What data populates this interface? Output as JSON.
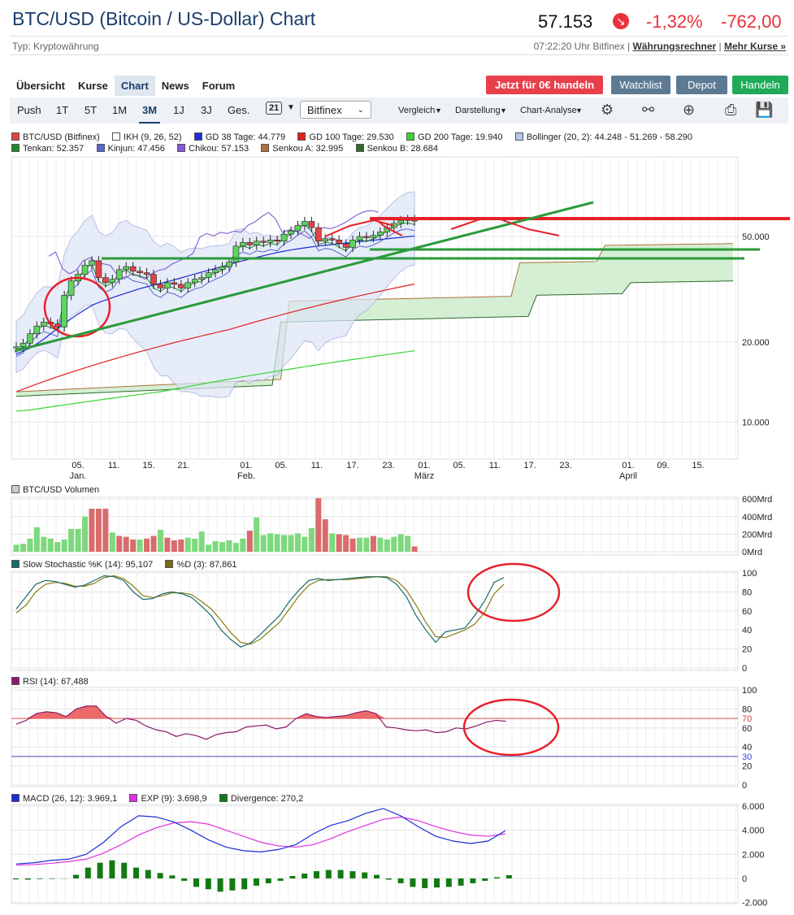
{
  "header": {
    "title": "BTC/USD (Bitcoin / US-Dollar) Chart",
    "price": "57.153",
    "change_pct": "-1,32%",
    "change_abs": "-762,00",
    "type_label": "Typ: Kryptowährung",
    "update_text": "07:22:20 Uhr Bitfinex |",
    "link_rechner": "Währungsrechner",
    "link_kurse": "Mehr Kurse »"
  },
  "nav": {
    "tabs": [
      "Übersicht",
      "Kurse",
      "Chart",
      "News",
      "Forum"
    ],
    "active_tab": "Chart",
    "trade_button": "Jetzt für 0€ handeln",
    "watchlist_button": "Watchlist",
    "depot_button": "Depot",
    "handeln_button": "Handeln"
  },
  "toolbar": {
    "ranges": [
      "Push",
      "1T",
      "5T",
      "1M",
      "3M",
      "1J",
      "3J",
      "Ges."
    ],
    "active_range": "3M",
    "calendar_day": "21",
    "exchange": "Bitfinex",
    "vergleich": "Vergleich",
    "darstellung": "Darstellung",
    "analyse": "Chart-Analyse"
  },
  "colors": {
    "up": "#5fd35f",
    "down": "#e04545",
    "gd38": "#1b2dd6",
    "gd100": "#e02020",
    "gd200": "#34d534",
    "boll": "#9aa8dd",
    "tenkan": "#1f8a2a",
    "kinjun": "#5566cc",
    "chikou": "#7a4dcc",
    "annotation": "#e8202a",
    "trend": "#2a9a3a"
  },
  "legend_main": [
    {
      "text": "BTC/USD (Bitfinex)",
      "color": "#e04545"
    },
    {
      "text": "IKH (9, 26, 52)",
      "color": "#ffffff"
    },
    {
      "text": "GD 38 Tage: 44.779",
      "color": "#1b2dd6"
    },
    {
      "text": "GD 100 Tage: 29.530",
      "color": "#e02020"
    },
    {
      "text": "GD 200 Tage: 19.940",
      "color": "#34d534"
    },
    {
      "text": "Bollinger (20, 2): 44.248 - 51.269 - 58.290",
      "color": "#b8c4e8"
    },
    {
      "text": "Tenkan: 52.357",
      "color": "#1f8a2a"
    },
    {
      "text": "Kinjun: 47.456",
      "color": "#5566cc"
    },
    {
      "text": "Chikou: 57.153",
      "color": "#8855dd"
    },
    {
      "text": "Senkou A: 32.995",
      "color": "#b07040"
    },
    {
      "text": "Senkou B: 28.684",
      "color": "#2d6b2d"
    }
  ],
  "legend_volume": "BTC/USD Volumen",
  "legend_stoch": [
    "Slow Stochastic %K (14): 95,107",
    "%D (3): 87,861"
  ],
  "legend_rsi": "RSI (14): 67,488",
  "legend_macd": [
    "MACD (26, 12): 3.969,1",
    "EXP (9): 3.698,9",
    "Divergence: 270,2"
  ],
  "chart_data": [
    {
      "type": "candlestick",
      "title": "BTC/USD (Bitfinex)",
      "yscale": "log",
      "ylim": [
        7000,
        80000
      ],
      "y_ticks": [
        "50.000",
        "20.000",
        "10.000"
      ],
      "x_ticks": [
        "05.",
        "11.",
        "15.",
        "21.",
        "01.",
        "05.",
        "11.",
        "17.",
        "23.",
        "01.",
        "05.",
        "11.",
        "17.",
        "23.",
        "01.",
        "09.",
        "15."
      ],
      "x_months": [
        "Jan.",
        "Feb.",
        "März",
        "April"
      ],
      "candles": [
        {
          "o": 19000,
          "c": 19200
        },
        {
          "o": 19200,
          "c": 19800
        },
        {
          "o": 19800,
          "c": 21500
        },
        {
          "o": 21500,
          "c": 23000
        },
        {
          "o": 23000,
          "c": 23800
        },
        {
          "o": 23800,
          "c": 23400
        },
        {
          "o": 23400,
          "c": 22800
        },
        {
          "o": 22800,
          "c": 30000
        },
        {
          "o": 30000,
          "c": 34000
        },
        {
          "o": 34000,
          "c": 36000
        },
        {
          "o": 36000,
          "c": 39000
        },
        {
          "o": 39000,
          "c": 40500
        },
        {
          "o": 40500,
          "c": 35000
        },
        {
          "o": 35000,
          "c": 33500
        },
        {
          "o": 33500,
          "c": 34500
        },
        {
          "o": 34500,
          "c": 37500
        },
        {
          "o": 37500,
          "c": 38500
        },
        {
          "o": 38500,
          "c": 37000
        },
        {
          "o": 37000,
          "c": 36500
        },
        {
          "o": 36500,
          "c": 36000
        },
        {
          "o": 36000,
          "c": 33000
        },
        {
          "o": 33000,
          "c": 32000
        },
        {
          "o": 32000,
          "c": 33500
        },
        {
          "o": 33500,
          "c": 33000
        },
        {
          "o": 33000,
          "c": 32000
        },
        {
          "o": 32000,
          "c": 33500
        },
        {
          "o": 33500,
          "c": 34500
        },
        {
          "o": 34500,
          "c": 35000
        },
        {
          "o": 35000,
          "c": 36500
        },
        {
          "o": 36500,
          "c": 37500
        },
        {
          "o": 37500,
          "c": 38500
        },
        {
          "o": 38500,
          "c": 40000
        },
        {
          "o": 40000,
          "c": 46000
        },
        {
          "o": 46000,
          "c": 47500
        },
        {
          "o": 47500,
          "c": 46500
        },
        {
          "o": 46500,
          "c": 48000
        },
        {
          "o": 48000,
          "c": 47500
        },
        {
          "o": 47500,
          "c": 48500
        },
        {
          "o": 48500,
          "c": 48000
        },
        {
          "o": 48000,
          "c": 51000
        },
        {
          "o": 51000,
          "c": 52500
        },
        {
          "o": 52500,
          "c": 55000
        },
        {
          "o": 55000,
          "c": 57000
        },
        {
          "o": 57000,
          "c": 54000
        },
        {
          "o": 54000,
          "c": 48000
        },
        {
          "o": 48000,
          "c": 49000
        },
        {
          "o": 49000,
          "c": 48500
        },
        {
          "o": 48500,
          "c": 47000
        },
        {
          "o": 47000,
          "c": 45500
        },
        {
          "o": 45500,
          "c": 48500
        },
        {
          "o": 48500,
          "c": 50000
        },
        {
          "o": 50000,
          "c": 49500
        },
        {
          "o": 49500,
          "c": 50500
        },
        {
          "o": 50500,
          "c": 52000
        },
        {
          "o": 52000,
          "c": 54000
        },
        {
          "o": 54000,
          "c": 56000
        },
        {
          "o": 56000,
          "c": 57500
        },
        {
          "o": 57500,
          "c": 58000
        },
        {
          "o": 58000,
          "c": 57153
        }
      ],
      "gd38": [
        18000,
        18500,
        19000,
        19700,
        20500,
        21500,
        22500,
        23500,
        24500,
        25500,
        26500,
        27500,
        28200,
        28800,
        29400,
        30000,
        30600,
        31200,
        31800,
        32300,
        32800,
        33300,
        33800,
        34300,
        34900,
        35500,
        36100,
        36700,
        37300,
        37900,
        38500,
        39200,
        39900,
        40500,
        41100,
        41700,
        42300,
        42900,
        43500,
        44000,
        44500,
        44900,
        45300,
        45700,
        46000,
        46300,
        46600,
        46900,
        47200,
        47500,
        47800,
        48100,
        48400,
        48700,
        49000,
        49300,
        49600,
        49900,
        50200
      ],
      "gd100": [
        13000,
        13300,
        13600,
        13900,
        14200,
        14500,
        14800,
        15100,
        15400,
        15700,
        16000,
        16300,
        16600,
        16900,
        17200,
        17500,
        17800,
        18100,
        18400,
        18700,
        19000,
        19300,
        19600,
        19900,
        20200,
        20500,
        20800,
        21100,
        21400,
        21700,
        22000,
        22300,
        22700,
        23100,
        23500,
        23900,
        24300,
        24700,
        25100,
        25500,
        25900,
        26300,
        26700,
        27100,
        27500,
        27900,
        28300,
        28700,
        29100,
        29500,
        29900,
        30300,
        30700,
        31100,
        31500,
        31900,
        32300,
        32700,
        33100
      ],
      "gd200": [
        11000,
        11050,
        11100,
        11200,
        11300,
        11400,
        11500,
        11600,
        11700,
        11800,
        11900,
        12000,
        12100,
        12200,
        12300,
        12400,
        12500,
        12600,
        12700,
        12800,
        12900,
        13000,
        13150,
        13300,
        13450,
        13600,
        13750,
        13900,
        14050,
        14200,
        14350,
        14500,
        14650,
        14800,
        14950,
        15100,
        15250,
        15400,
        15550,
        15700,
        15850,
        16000,
        16150,
        16300,
        16450,
        16600,
        16750,
        16900,
        17050,
        17200,
        17350,
        17500,
        17650,
        17800,
        17950,
        18100,
        18250,
        18400,
        18550
      ],
      "annotations": [
        "red-circle-early-jan",
        "red-resistance-line",
        "green-uptrend-line",
        "green-support-lines",
        "red-wedge-tops"
      ]
    },
    {
      "type": "bar",
      "title": "BTC/USD Volumen",
      "y_ticks": [
        "600Mrd",
        "400Mrd",
        "200Mrd",
        "0Mrd"
      ],
      "ylim": [
        0,
        650
      ],
      "values": [
        80,
        90,
        150,
        280,
        170,
        150,
        110,
        140,
        260,
        260,
        400,
        490,
        490,
        490,
        220,
        180,
        170,
        140,
        140,
        150,
        180,
        250,
        160,
        130,
        140,
        160,
        150,
        230,
        80,
        120,
        110,
        130,
        100,
        150,
        240,
        390,
        190,
        210,
        200,
        190,
        190,
        210,
        170,
        270,
        610,
        370,
        210,
        200,
        190,
        150,
        160,
        160,
        180,
        160,
        140,
        170,
        200,
        180,
        60
      ],
      "up": [
        1,
        1,
        1,
        1,
        1,
        1,
        1,
        1,
        1,
        1,
        1,
        0,
        0,
        0,
        1,
        0,
        0,
        0,
        1,
        0,
        0,
        1,
        0,
        0,
        0,
        1,
        1,
        1,
        1,
        1,
        1,
        1,
        1,
        1,
        0,
        1,
        1,
        1,
        1,
        1,
        1,
        1,
        1,
        1,
        0,
        0,
        1,
        0,
        0,
        0,
        1,
        1,
        0,
        1,
        1,
        1,
        1,
        1,
        0
      ]
    },
    {
      "type": "line",
      "title": "Slow Stochastic",
      "y_ticks": [
        "100",
        "80",
        "60",
        "40",
        "20",
        "0"
      ],
      "ylim": [
        0,
        100
      ],
      "series": [
        {
          "name": "%K (14)",
          "values": [
            62,
            75,
            88,
            92,
            91,
            88,
            85,
            87,
            92,
            97,
            96,
            92,
            80,
            72,
            73,
            78,
            80,
            78,
            74,
            65,
            55,
            40,
            30,
            22,
            26,
            35,
            45,
            55,
            70,
            82,
            92,
            94,
            92,
            93,
            94,
            95,
            96,
            96,
            95,
            88,
            75,
            55,
            40,
            27,
            38,
            40,
            42,
            55,
            70,
            90,
            95
          ]
        },
        {
          "name": "%D (3)",
          "values": [
            58,
            66,
            80,
            88,
            90,
            89,
            86,
            86,
            89,
            95,
            97,
            94,
            86,
            76,
            74,
            76,
            79,
            79,
            77,
            70,
            62,
            50,
            37,
            27,
            25,
            30,
            39,
            48,
            62,
            76,
            87,
            92,
            93,
            93,
            93,
            94,
            95,
            96,
            96,
            92,
            82,
            66,
            48,
            33,
            32,
            36,
            40,
            46,
            58,
            78,
            88
          ]
        }
      ]
    },
    {
      "type": "area",
      "title": "RSI (14)",
      "y_ticks": [
        "100",
        "80",
        "70",
        "60",
        "40",
        "30",
        "20",
        "0"
      ],
      "ylim": [
        0,
        100
      ],
      "reference_lines": [
        70,
        30
      ],
      "values": [
        64,
        68,
        75,
        77,
        76,
        72,
        80,
        83,
        83,
        72,
        65,
        70,
        68,
        62,
        58,
        56,
        51,
        54,
        52,
        48,
        53,
        55,
        56,
        61,
        62,
        63,
        59,
        61,
        70,
        75,
        72,
        71,
        72,
        73,
        76,
        78,
        75,
        61,
        60,
        58,
        57,
        58,
        55,
        56,
        60,
        59,
        62,
        66,
        68,
        67
      ]
    },
    {
      "type": "line",
      "title": "MACD",
      "y_ticks": [
        "6.000",
        "4.000",
        "2.000",
        "0",
        "-2.000"
      ],
      "ylim": [
        -2000,
        6000
      ],
      "series": [
        {
          "name": "MACD (26, 12)",
          "values": [
            1200,
            1300,
            1500,
            1600,
            2000,
            3000,
            4300,
            5200,
            5100,
            4700,
            4000,
            3200,
            2600,
            2300,
            2200,
            2400,
            2800,
            3700,
            4400,
            4800,
            5400,
            5800,
            5200,
            4300,
            3500,
            3100,
            2900,
            3100,
            3969
          ]
        },
        {
          "name": "EXP (9)",
          "values": [
            1100,
            1150,
            1250,
            1400,
            1600,
            2100,
            2800,
            3600,
            4200,
            4600,
            4700,
            4500,
            4000,
            3500,
            3000,
            2700,
            2600,
            2800,
            3300,
            3900,
            4400,
            4900,
            5100,
            4800,
            4300,
            3900,
            3600,
            3500,
            3699
          ]
        }
      ],
      "divergence": [
        -80,
        -100,
        -50,
        -40,
        -20,
        300,
        900,
        1300,
        1500,
        1300,
        900,
        700,
        450,
        250,
        -200,
        -700,
        -900,
        -1100,
        -1000,
        -900,
        -600,
        -400,
        -200,
        200,
        400,
        600,
        700,
        700,
        600,
        500,
        300,
        -100,
        -400,
        -700,
        -800,
        -750,
        -700,
        -600,
        -400,
        -200,
        100,
        270
      ]
    }
  ]
}
